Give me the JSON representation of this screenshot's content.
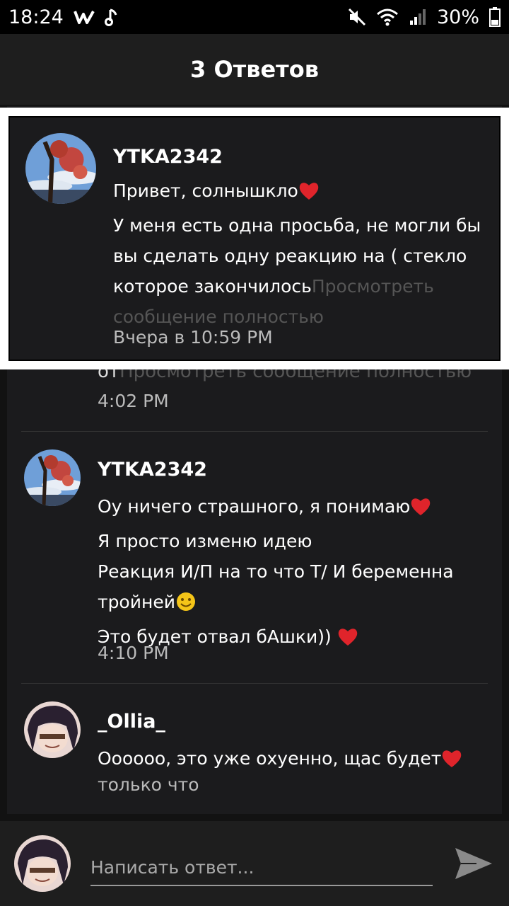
{
  "status_bar": {
    "time": "18:24",
    "battery": "30%"
  },
  "header": {
    "title": "3 Ответов"
  },
  "thread": {
    "hidden_snippet_start": "от",
    "hidden_snippet_more": "Просмотреть сообщение полностью",
    "hidden_time": "4:02 PM",
    "replies": [
      {
        "username": "YTKA2342",
        "lines": [
          "Оу ничего страшного, я понимаю",
          "Я просто изменю идею",
          "Реакция И/П на то что Т/ И беременна",
          "тройней",
          "Это будет отвал бАшки))"
        ],
        "time": "4:10 PM"
      },
      {
        "username": "_Ollia_",
        "lines": [
          "Оооооо, это уже охуенно, щас будет"
        ],
        "time": "только что"
      }
    ]
  },
  "popup": {
    "username": "YTKA2342",
    "lines": [
      "Привет, солнышкло",
      "У меня есть одна просьба, не могли бы",
      "вы сделать одну реакцию на ( стекло",
      "которое закончилось"
    ],
    "more_1": "Просмотреть",
    "more_2": "сообщение полностью",
    "time": "Вчера в 10:59 PM"
  },
  "composer": {
    "placeholder": "Написать ответ..."
  },
  "colors": {
    "background": "#121212",
    "heart": "#e0242b",
    "smile": "#f5c518"
  }
}
